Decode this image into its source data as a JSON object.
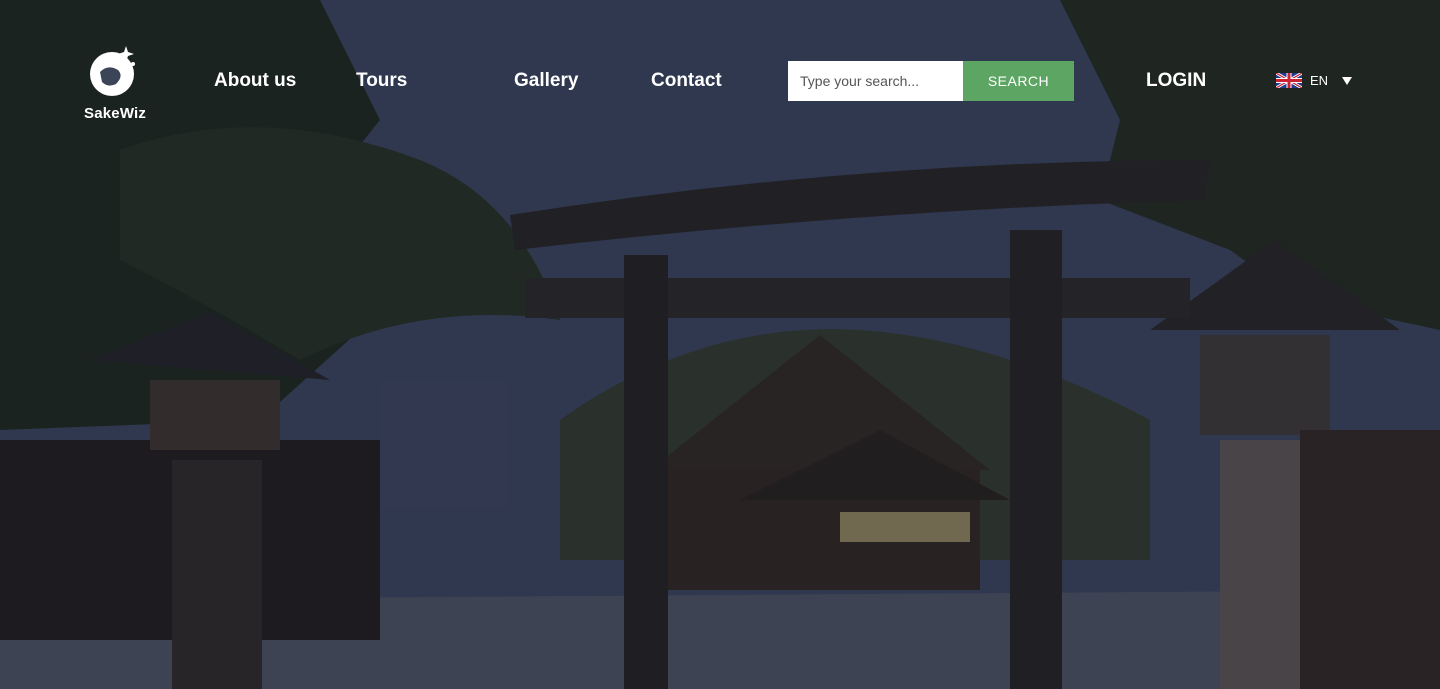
{
  "brand": {
    "name": "SakeWiz",
    "logo_icon": "sakewiz-logo-icon"
  },
  "nav": {
    "about": "About us",
    "tours": "Tours",
    "gallery": "Gallery",
    "contact": "Contact"
  },
  "search": {
    "placeholder": "Type your search...",
    "button_label": "SEARCH"
  },
  "account": {
    "login_label": "LOGIN"
  },
  "language": {
    "code": "EN",
    "flag_icon": "uk-flag-icon"
  },
  "colors": {
    "search_button": "#5da563",
    "text": "#ffffff"
  }
}
